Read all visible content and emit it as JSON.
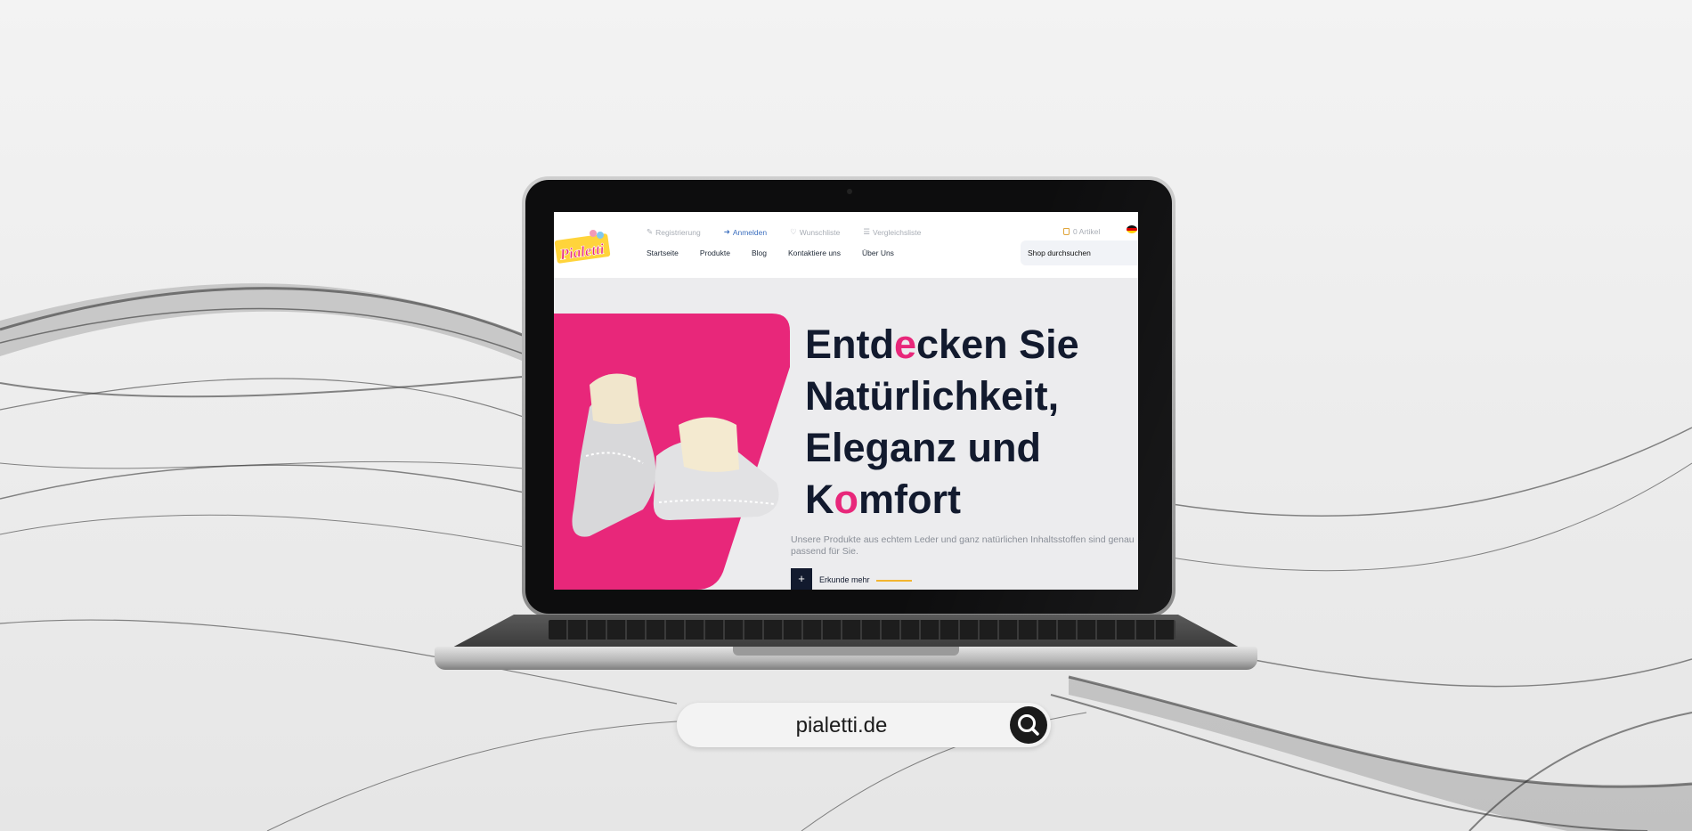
{
  "site": {
    "logo_text": "Pialetti",
    "top_links": [
      {
        "label": "Registrierung",
        "icon": "pencil-icon"
      },
      {
        "label": "Anmelden",
        "icon": "login-icon"
      },
      {
        "label": "Wunschliste",
        "icon": "heart-icon"
      },
      {
        "label": "Vergleichsliste",
        "icon": "list-icon"
      }
    ],
    "cart_label": "0 Artikel",
    "nav": [
      "Startseite",
      "Produkte",
      "Blog",
      "Kontaktiere uns",
      "Über Uns"
    ],
    "search_placeholder": "Shop durchsuchen"
  },
  "hero": {
    "title_parts": [
      "Entd",
      "e",
      "cken Sie",
      "Natürlichkeit,",
      "Eleganz und",
      "K",
      "o",
      "mfort"
    ],
    "text": "Unsere Produkte aus echtem Leder und ganz natürlichen Inhaltsstoffen sind genau passend für Sie.",
    "cta_icon": "+",
    "cta_label": "Erkunde mehr"
  },
  "url_bar": {
    "text": "pialetti.de",
    "icon": "search-icon"
  },
  "colors": {
    "accent_pink": "#e8277a",
    "navy": "#121a2e",
    "gold": "#f2b530",
    "link_blue": "#3c6fbf"
  }
}
